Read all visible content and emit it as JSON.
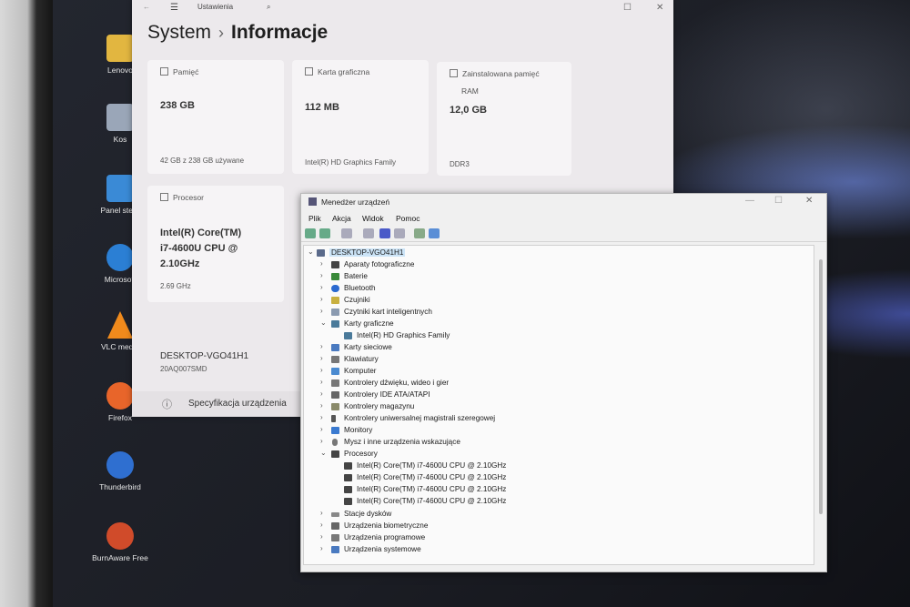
{
  "desktop": {
    "icons": [
      {
        "label": "Lenovo",
        "color": "#e2b640"
      },
      {
        "label": "Kos",
        "color": "#9aa6b8"
      },
      {
        "label": "Panel stero",
        "color": "#3a8ad6"
      },
      {
        "label": "Microsoft",
        "color": "#2b7fd4"
      },
      {
        "label": "VLC media",
        "color": "#f08a1c"
      },
      {
        "label": "Firefox",
        "color": "#e8652a"
      },
      {
        "label": "Thunderbird",
        "color": "#2f6fd0"
      },
      {
        "label": "BurnAware Free",
        "color": "#d04b2a"
      }
    ]
  },
  "settings": {
    "app_title": "Ustawienia",
    "breadcrumb_parent": "System",
    "breadcrumb_sep": "›",
    "breadcrumb_current": "Informacje",
    "storage": {
      "label": "Pamięć",
      "value": "238 GB",
      "sub": "42 GB z 238 GB używane"
    },
    "gpu": {
      "label": "Karta graficzna",
      "value": "112 MB",
      "sub": "Intel(R) HD Graphics Family"
    },
    "ram": {
      "label": "Zainstalowana pamięć",
      "label2": "RAM",
      "value": "12,0 GB",
      "sub": "DDR3"
    },
    "cpu": {
      "label": "Procesor",
      "value1": "Intel(R) Core(TM)",
      "value2": "i7-4600U CPU @",
      "value3": "2.10GHz",
      "sub": "2.69 GHz"
    },
    "device": {
      "name": "DESKTOP-VGO41H1",
      "model": "20AQ007SMD"
    },
    "spec_label": "Specyfikacja urządzenia"
  },
  "devmgr": {
    "title": "Menedżer urządzeń",
    "menu": [
      "Plik",
      "Akcja",
      "Widok",
      "Pomoc"
    ],
    "root": "DESKTOP-VGO41H1",
    "categories": {
      "aparaty": "Aparaty fotograficzne",
      "baterie": "Baterie",
      "bluetooth": "Bluetooth",
      "czujniki": "Czujniki",
      "czytniki": "Czytniki kart inteligentnych",
      "karty_graficzne": "Karty graficzne",
      "gpu_child": "Intel(R) HD Graphics Family",
      "karty_sieciowe": "Karty sieciowe",
      "klawiatury": "Klawiatury",
      "komputer": "Komputer",
      "kontrolery_dzwieku": "Kontrolery dźwięku, wideo i gier",
      "kontrolery_ide": "Kontrolery IDE ATA/ATAPI",
      "kontrolery_magazynu": "Kontrolery magazynu",
      "kontrolery_usb": "Kontrolery uniwersalnej magistrali szeregowej",
      "monitory": "Monitory",
      "mysz": "Mysz i inne urządzenia wskazujące",
      "procesory": "Procesory",
      "cpu_child": "Intel(R) Core(TM) i7-4600U CPU @ 2.10GHz",
      "stacje": "Stacje dysków",
      "biometryczne": "Urządzenia biometryczne",
      "programowe": "Urządzenia programowe",
      "systemowe": "Urządzenia systemowe"
    }
  }
}
